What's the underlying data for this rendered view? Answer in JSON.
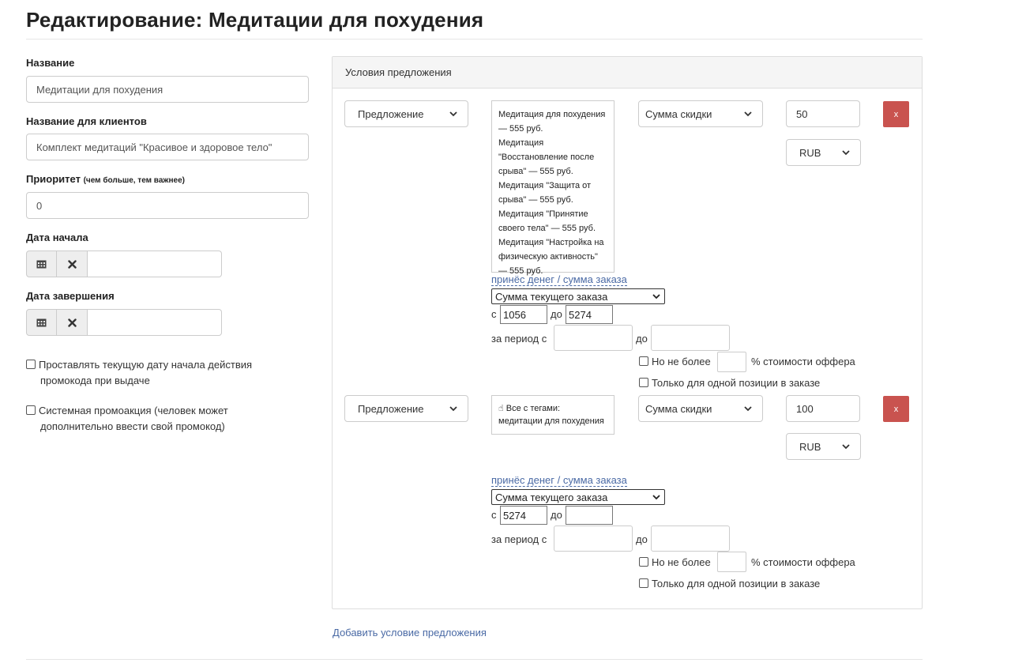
{
  "page": {
    "title": "Редактирование: Медитации для похудения"
  },
  "form": {
    "name_label": "Название",
    "name_value": "Медитации для похудения",
    "client_name_label": "Название для клиентов",
    "client_name_value": "Комплект медитаций \"Красивое и здоровое тело\"",
    "priority_label": "Приоритет",
    "priority_hint": "(чем больше, тем важнее)",
    "priority_value": "0",
    "start_date_label": "Дата начала",
    "end_date_label": "Дата завершения",
    "checkbox1_line1": "Проставлять текущую дату начала действия",
    "checkbox1_line2": "промокода при выдаче",
    "checkbox2_line1": "Системная промоакция (человек может",
    "checkbox2_line2": "дополнительно ввести свой промокод)"
  },
  "panel": {
    "title": "Условия предложения",
    "add_link": "Добавить условие предложения"
  },
  "conditions": [
    {
      "type": "Предложение",
      "products": [
        "Медитация для похудения — 555 руб.",
        "Медитация \"Восстановление после срыва\" — 555 руб.",
        "Медитация \"Защита от срыва\" — 555 руб.",
        "Медитация \"Принятие своего тела\" — 555 руб.",
        "Медитация \"Настройка на физическую активность\" — 555 руб."
      ],
      "discount_type": "Сумма скидки",
      "amount": "50",
      "currency": "RUB",
      "delete_label": "x",
      "money_link": "принёс денег / сумма заказа",
      "order_sum": "Сумма текущего заказа",
      "from_label": "с",
      "from_value": "1056",
      "to_label": "до",
      "to_value": "5274",
      "period_from_label": "за период с",
      "period_to_label": "до",
      "limit_prefix": "Но не более",
      "limit_suffix": "% стоимости оффера",
      "single_position": "Только для одной позиции в заказе"
    },
    {
      "type": "Предложение",
      "tag_icon": "hand-pointer",
      "tags_line1": "Все с тегами:",
      "tags_line2": "медитации для похудения",
      "discount_type": "Сумма скидки",
      "amount": "100",
      "currency": "RUB",
      "delete_label": "x",
      "money_link": "принёс денег / сумма заказа",
      "order_sum": "Сумма текущего заказа",
      "from_label": "с",
      "from_value": "5274",
      "to_label": "до",
      "to_value": "",
      "period_from_label": "за период с",
      "period_to_label": "до",
      "limit_prefix": "Но не более",
      "limit_suffix": "% стоимости оффера",
      "single_position": "Только для одной позиции в заказе"
    }
  ],
  "colors": {
    "danger": "#c9534f",
    "link": "#4a6aa5",
    "panel_head": "#f5f5f5"
  }
}
